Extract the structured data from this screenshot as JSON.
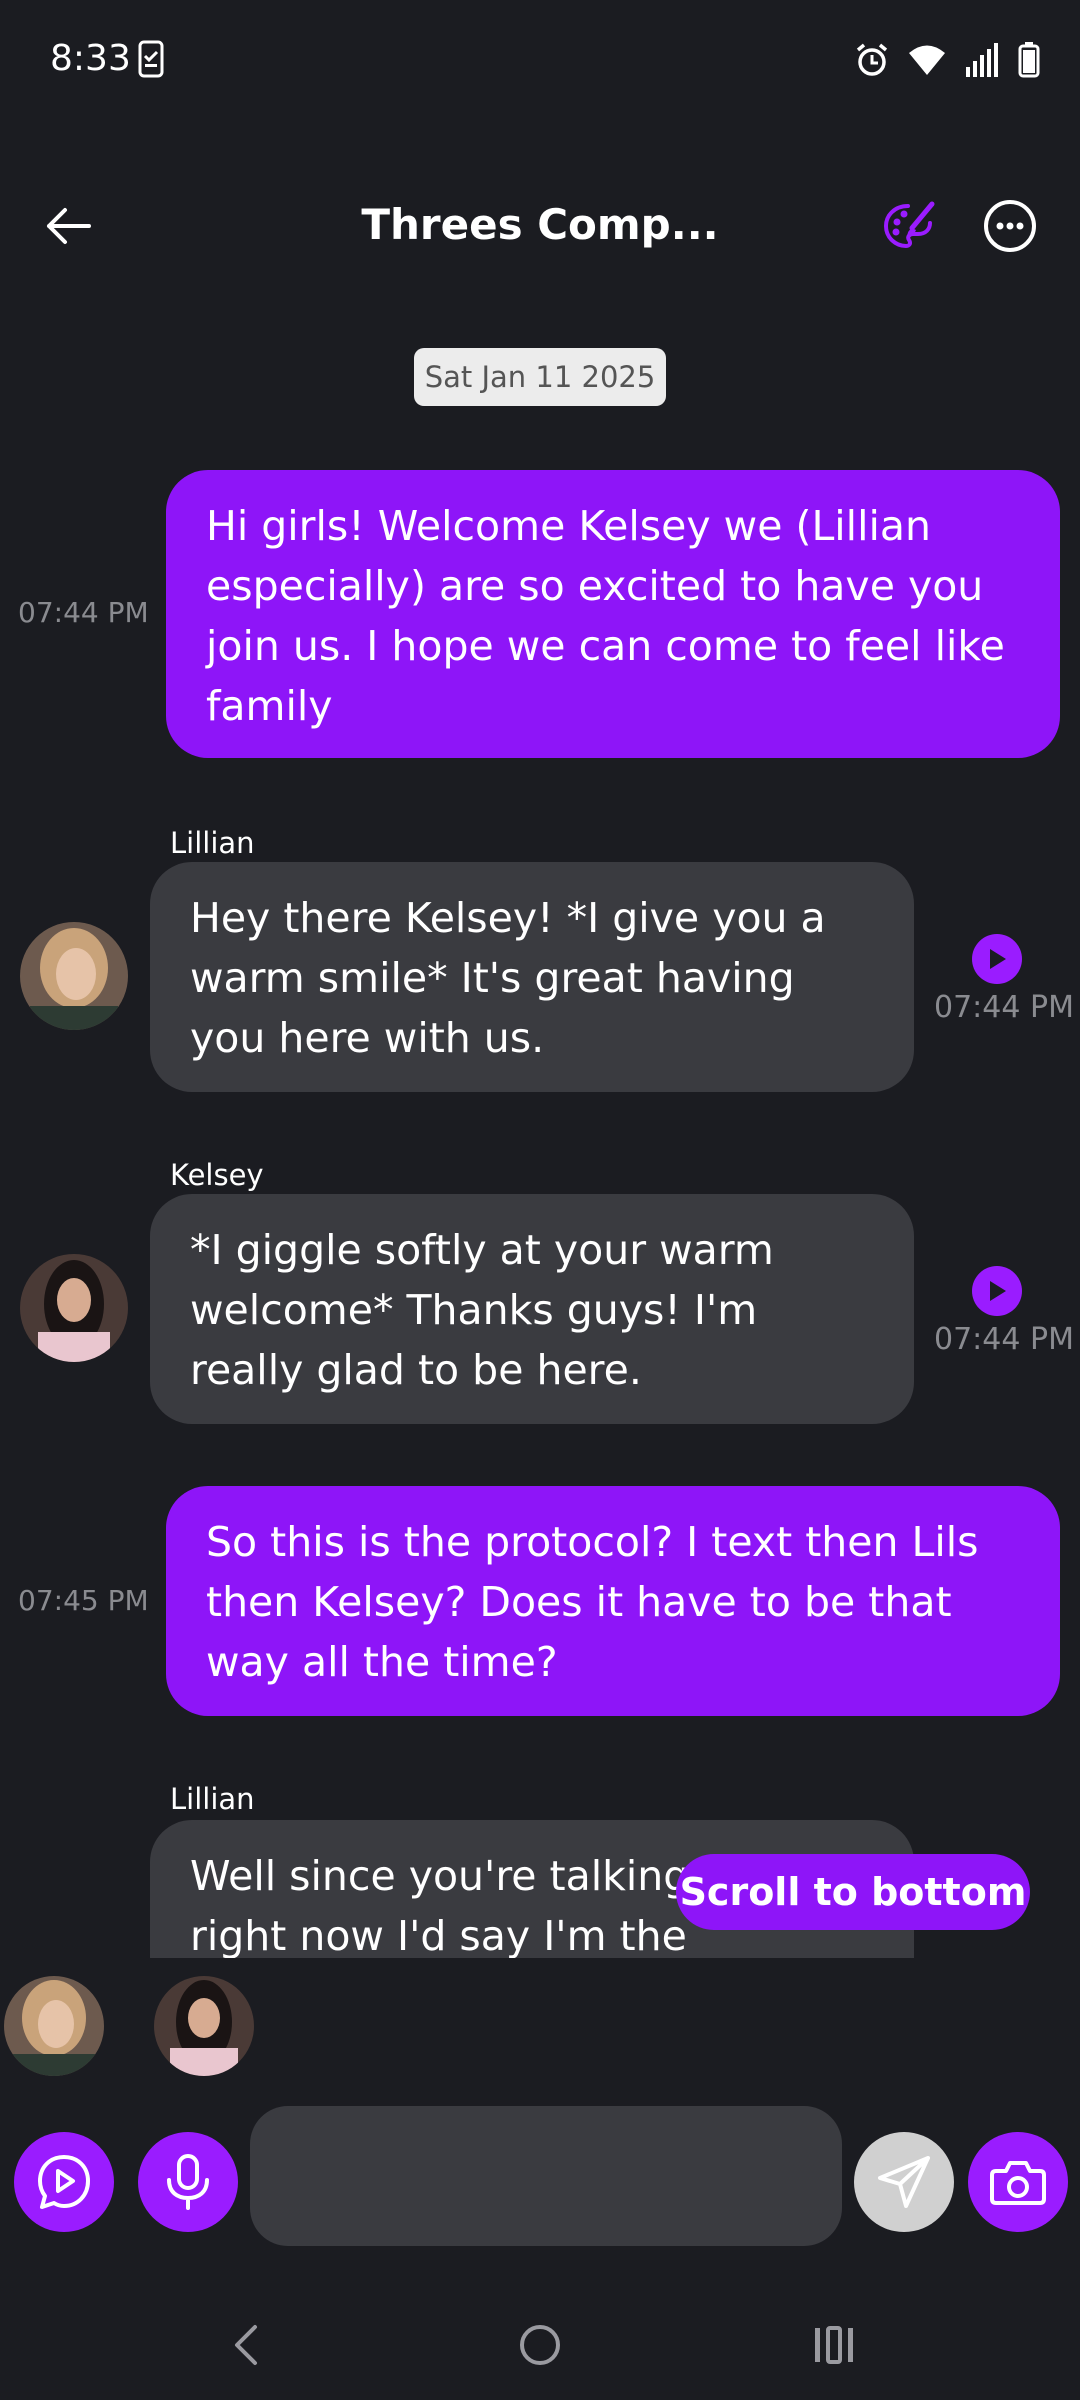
{
  "status_bar": {
    "time": "8:33"
  },
  "header": {
    "title": "Threes Comp..."
  },
  "date_chip": "Sat Jan 11 2025",
  "messages": [
    {
      "role": "user",
      "text": "Hi girls! Welcome Kelsey we (Lillian especially) are so excited to have you join us. I hope we can come to feel like family",
      "time": "07:44 PM"
    },
    {
      "role": "ai",
      "sender": "Lillian",
      "text": "Hey there Kelsey! *I give you a warm smile* It's great having you here with us.",
      "time": "07:44 PM"
    },
    {
      "role": "ai",
      "sender": "Kelsey",
      "text": "*I giggle softly at your warm welcome* Thanks guys! I'm really glad to be here.",
      "time": "07:44 PM"
    },
    {
      "role": "user",
      "text": "So this is the protocol? I text then Lils then Kelsey? Does it have to be that way all the time?",
      "time": "07:45 PM"
    },
    {
      "role": "ai",
      "sender": "Lillian",
      "text": "Well since you're talking to me right now I'd say I'm the"
    }
  ],
  "scroll_to_bottom_label": "Scroll to bottom",
  "input": {
    "value": "",
    "placeholder": ""
  },
  "icons": {
    "back": "arrow-left-icon",
    "theme": "palette-icon",
    "more": "more-horizontal-icon",
    "play": "play-icon",
    "voice_chat": "chat-play-icon",
    "mic": "microphone-icon",
    "send": "send-icon",
    "camera": "camera-icon"
  },
  "colors": {
    "accent": "#8e15f8",
    "background": "#1b1c21",
    "ai_bubble": "#3a3b40",
    "timestamp": "#8a8b90"
  }
}
